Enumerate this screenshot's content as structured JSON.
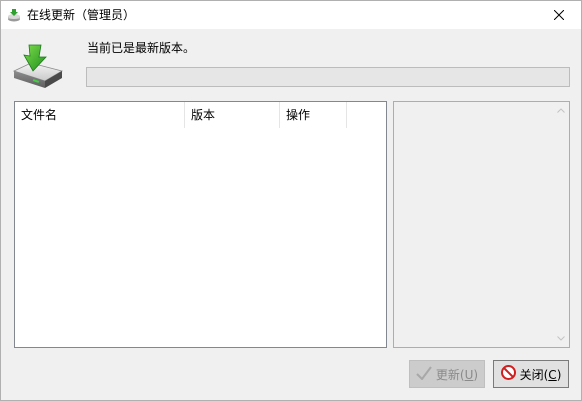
{
  "window": {
    "title": "在线更新（管理员）"
  },
  "status": {
    "message": "当前已是最新版本。",
    "progress": 0
  },
  "list": {
    "columns": [
      "文件名",
      "版本",
      "操作"
    ],
    "rows": []
  },
  "buttons": {
    "update_label": "更新(",
    "update_key": "U",
    "update_suffix": ")",
    "close_label": "关闭(",
    "close_key": "C",
    "close_suffix": ")"
  },
  "icons": {
    "title": "update-icon",
    "main": "drive-download-icon",
    "update": "check-icon",
    "close": "stop-icon",
    "window_close": "close-icon"
  },
  "colors": {
    "accent_green": "#2ea12e",
    "stop_red": "#d11e1e"
  }
}
